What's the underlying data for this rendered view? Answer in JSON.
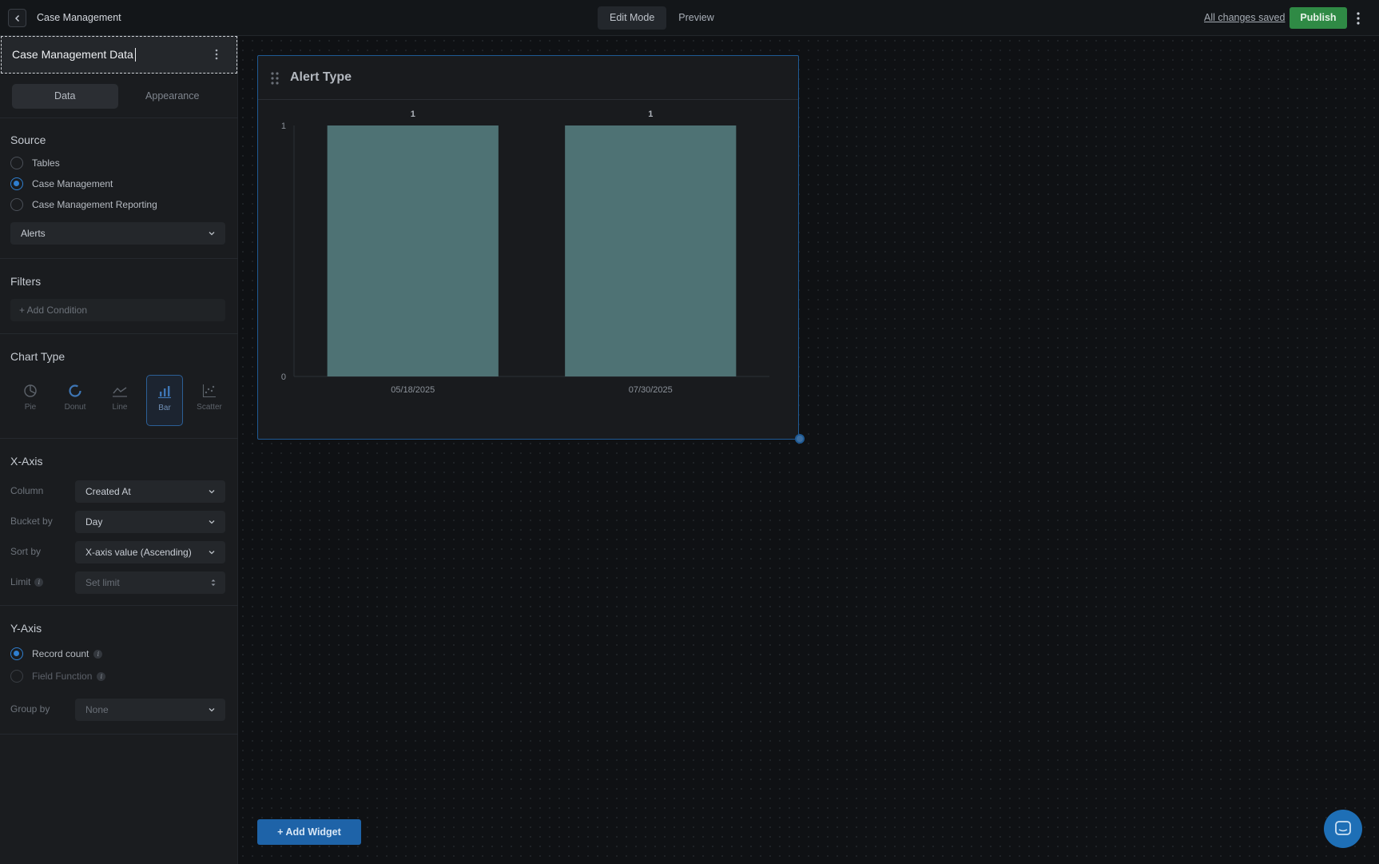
{
  "app": {
    "title": "Case Management"
  },
  "modes": [
    {
      "label": "Edit Mode",
      "active": true
    },
    {
      "label": "Preview",
      "active": false
    }
  ],
  "header": {
    "status": "All changes saved",
    "publish_label": "Publish"
  },
  "sidebar": {
    "widget_name": "Case Management Data",
    "tabs": [
      {
        "label": "Data",
        "active": true
      },
      {
        "label": "Appearance",
        "active": false
      }
    ],
    "source": {
      "title": "Source",
      "options": [
        {
          "label": "Tables",
          "checked": false
        },
        {
          "label": "Case Management",
          "checked": true
        },
        {
          "label": "Case Management Reporting",
          "checked": false
        }
      ],
      "selected": "Alerts"
    },
    "filters": {
      "title": "Filters",
      "add_label": "+ Add Condition"
    },
    "chart_type": {
      "title": "Chart Type",
      "options": [
        {
          "label": "Pie",
          "icon": "pie-icon",
          "active": false
        },
        {
          "label": "Donut",
          "icon": "donut-icon",
          "active": false
        },
        {
          "label": "Line",
          "icon": "line-chart-icon",
          "active": false
        },
        {
          "label": "Bar",
          "icon": "bar-chart-icon",
          "active": true
        },
        {
          "label": "Scatter",
          "icon": "scatter-icon",
          "active": false
        }
      ]
    },
    "x_axis": {
      "title": "X-Axis",
      "column_label": "Column",
      "column_value": "Created At",
      "bucket_label": "Bucket by",
      "bucket_value": "Day",
      "sort_label": "Sort by",
      "sort_value": "X-axis value (Ascending)",
      "limit_label": "Limit",
      "limit_placeholder": "Set limit"
    },
    "y_axis": {
      "title": "Y-Axis",
      "options": [
        {
          "label": "Record count",
          "checked": true,
          "disabled": false
        },
        {
          "label": "Field Function",
          "checked": false,
          "disabled": true
        }
      ],
      "group_label": "Group by",
      "group_value": "None"
    }
  },
  "canvas": {
    "add_widget_label": "+ Add Widget"
  },
  "widget": {
    "title": "Alert Type"
  },
  "chart_data": {
    "type": "bar",
    "title": "Alert Type",
    "categories": [
      "05/18/2025",
      "07/30/2025"
    ],
    "values": [
      1,
      1
    ],
    "data_labels": [
      "1",
      "1"
    ],
    "y_ticks": [
      "0",
      "1"
    ],
    "ylim": [
      0,
      1
    ],
    "xlabel": "",
    "ylabel": "",
    "bar_color": "#4e7274",
    "grid": false
  },
  "colors": {
    "accent": "#2f7fd0",
    "publish": "#2f8a45",
    "bar": "#4e7274"
  }
}
